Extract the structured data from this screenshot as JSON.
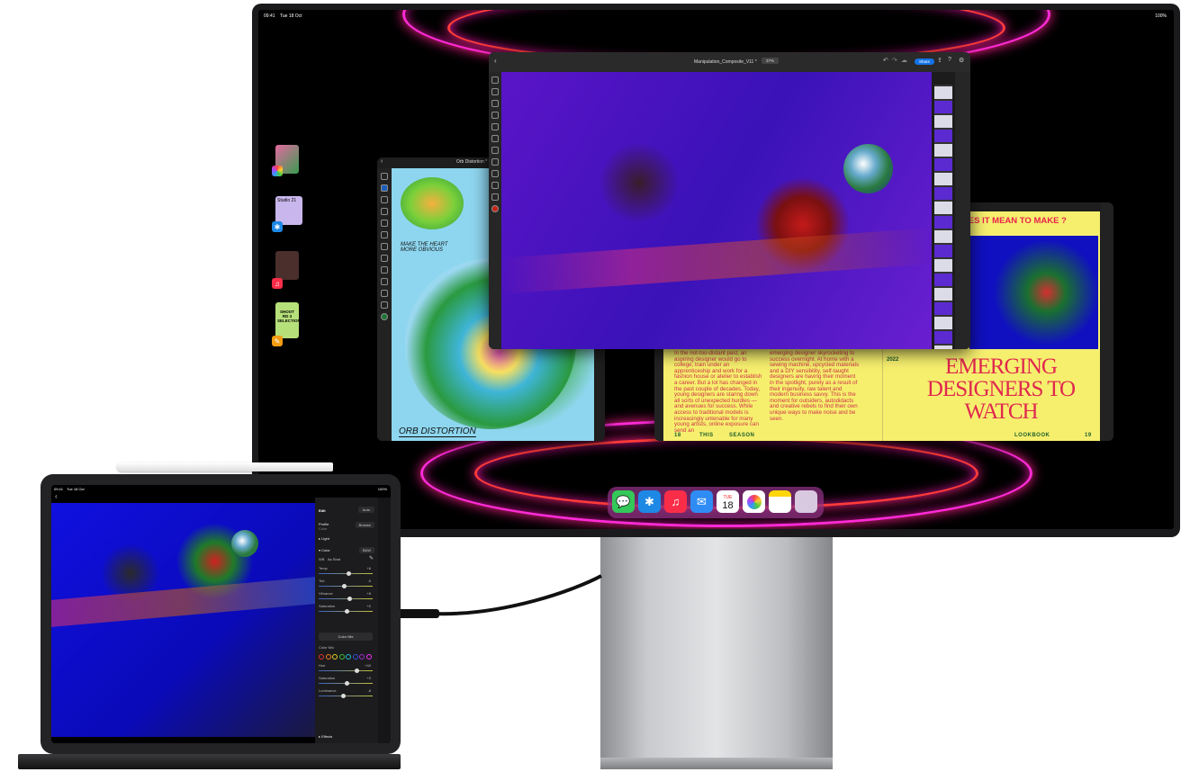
{
  "external_display": {
    "status_bar": {
      "time": "09:41",
      "date": "Tue 18 Oct",
      "battery": "100%"
    },
    "stage_manager": [
      {
        "app": "Photos",
        "icon": "photos-icon"
      },
      {
        "app": "Safari",
        "icon": "safari-icon",
        "thumbnail_text": "Studio 21"
      },
      {
        "app": "Music",
        "icon": "music-icon"
      },
      {
        "app": "Pages",
        "icon": "pages-icon",
        "thumbnail_text": "SHOOT RD 3 SELECTIONS"
      }
    ],
    "photoshop_window": {
      "document_title": "Manipulation_Composite_V11 *",
      "zoom": "37%",
      "share_label": "Share"
    },
    "fresco_window": {
      "document_title": "Orb Distortion *",
      "note": "MAKE THE HEART MORE OBVIOUS",
      "artwork_title": "ORB DISTORTION"
    },
    "indesign_window": {
      "headline_small": "WHAT DOES IT MEAN TO MAKE ?",
      "year": "2022",
      "headline": "EMERGING DESIGNERS TO WATCH",
      "body_col1": "In the not-too-distant past, an aspiring designer would go to college, train under an apprenticeship and work for a fashion house or atelier to establish a career. But a lot has changed in the past couple of decades. Today, young designers are staring down all sorts of unexpected hurdles — and avenues for success. While access to traditional models is increasingly untenable for many young artists, online exposure can send an",
      "body_col2": "emerging designer skyrocketing to success overnight. At home with a sewing machine, upcycled materials and a DIY sensibility, self-taught designers are having their moment in the spotlight, purely as a result of their ingenuity, raw talent and modern business savvy. This is the moment for outsiders, autodidacts and creative rebels to find their own unique ways to make noise and be seen.",
      "footer_left": [
        "18",
        "THIS",
        "SEASON"
      ],
      "footer_right": [
        "LOOKBOOK",
        "19"
      ]
    },
    "dock": [
      {
        "app": "Messages",
        "icon": "messages-icon",
        "color": "#34c759"
      },
      {
        "app": "Safari",
        "icon": "safari-icon",
        "color": "#1e88e5"
      },
      {
        "app": "Music",
        "icon": "music-icon",
        "color": "#fa2d48"
      },
      {
        "app": "Mail",
        "icon": "mail-icon",
        "color": "#2f8cf5"
      },
      {
        "app": "Calendar",
        "icon": "calendar-icon",
        "day": "TUE",
        "date": "18"
      },
      {
        "app": "Photos",
        "icon": "photos-icon"
      },
      {
        "app": "Notes",
        "icon": "notes-icon"
      },
      {
        "app": "App Library",
        "icon": "app-library-icon"
      }
    ]
  },
  "ipad": {
    "status_bar": {
      "time": "09:41",
      "date": "Tue 18 Oct",
      "battery": "100%"
    },
    "lightroom": {
      "panel_title": "Edit",
      "auto_label": "Auto",
      "profile_label": "Profile",
      "profile_value": "Color",
      "browse_label": "Browse",
      "light_label": "Light",
      "color_label": "Color",
      "bw_label": "B&W",
      "wb_label": "WB",
      "wb_value": "As Shot",
      "sliders": [
        {
          "label": "Temp",
          "value": "+6",
          "position": 0.55
        },
        {
          "label": "Tint",
          "value": "-5",
          "position": 0.48
        },
        {
          "label": "Vibrance",
          "value": "+8",
          "position": 0.57
        },
        {
          "label": "Saturation",
          "value": "+0",
          "position": 0.52
        }
      ],
      "color_mix_button": "Color Mix",
      "color_mix_label": "Color Mix",
      "color_swatches": [
        "#e03030",
        "#f08020",
        "#e0d020",
        "#40c040",
        "#20c0d0",
        "#3050e0",
        "#a030d0",
        "#ff30ff"
      ],
      "mix_sliders": [
        {
          "label": "Hue",
          "value": "+40",
          "position": 0.7
        },
        {
          "label": "Saturation",
          "value": "+0",
          "position": 0.52
        },
        {
          "label": "Luminance",
          "value": "-8",
          "position": 0.45
        }
      ],
      "effects_label": "Effects"
    }
  }
}
